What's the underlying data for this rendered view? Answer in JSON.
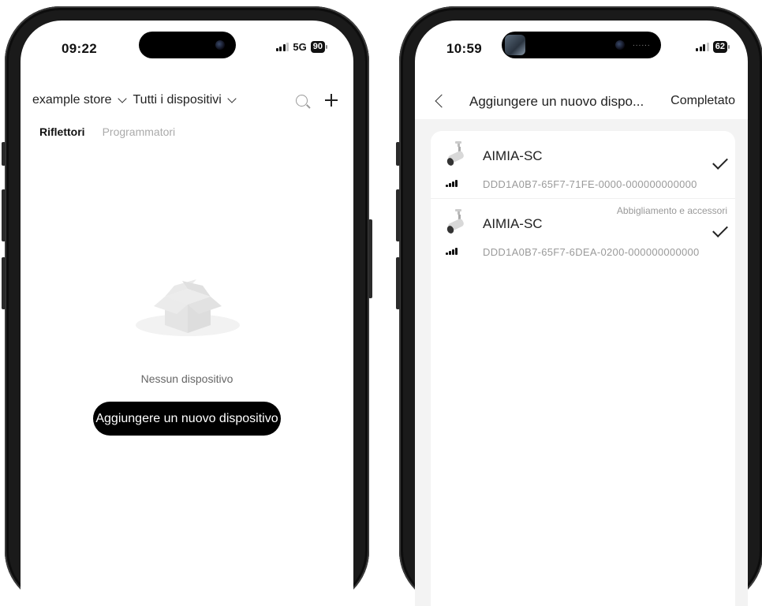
{
  "left_phone": {
    "status": {
      "time": "09:22",
      "network": "5G",
      "battery": "90"
    },
    "toolbar": {
      "store": "example store",
      "device_filter": "Tutti i dispositivi"
    },
    "tabs": [
      {
        "label": "Riflettori",
        "active": true
      },
      {
        "label": "Programmatori",
        "active": false
      }
    ],
    "empty": {
      "message": "Nessun dispositivo",
      "add_button": "Aggiungere un nuovo dispositivo"
    }
  },
  "right_phone": {
    "status": {
      "time": "10:59",
      "dots": "......",
      "battery": "62"
    },
    "nav": {
      "title": "Aggiungere un nuovo dispo...",
      "done": "Completato"
    },
    "devices": [
      {
        "name": "AIMIA-SC",
        "id": "DDD1A0B7-65F7-71FE-0000-000000000000",
        "category": "",
        "selected": true
      },
      {
        "name": "AIMIA-SC",
        "id": "DDD1A0B7-65F7-6DEA-0200-000000000000",
        "category": "Abbigliamento e accessori",
        "selected": true
      }
    ]
  },
  "colors": {
    "accent": "#000000",
    "muted": "#999999",
    "background": "#f3f3f3"
  }
}
